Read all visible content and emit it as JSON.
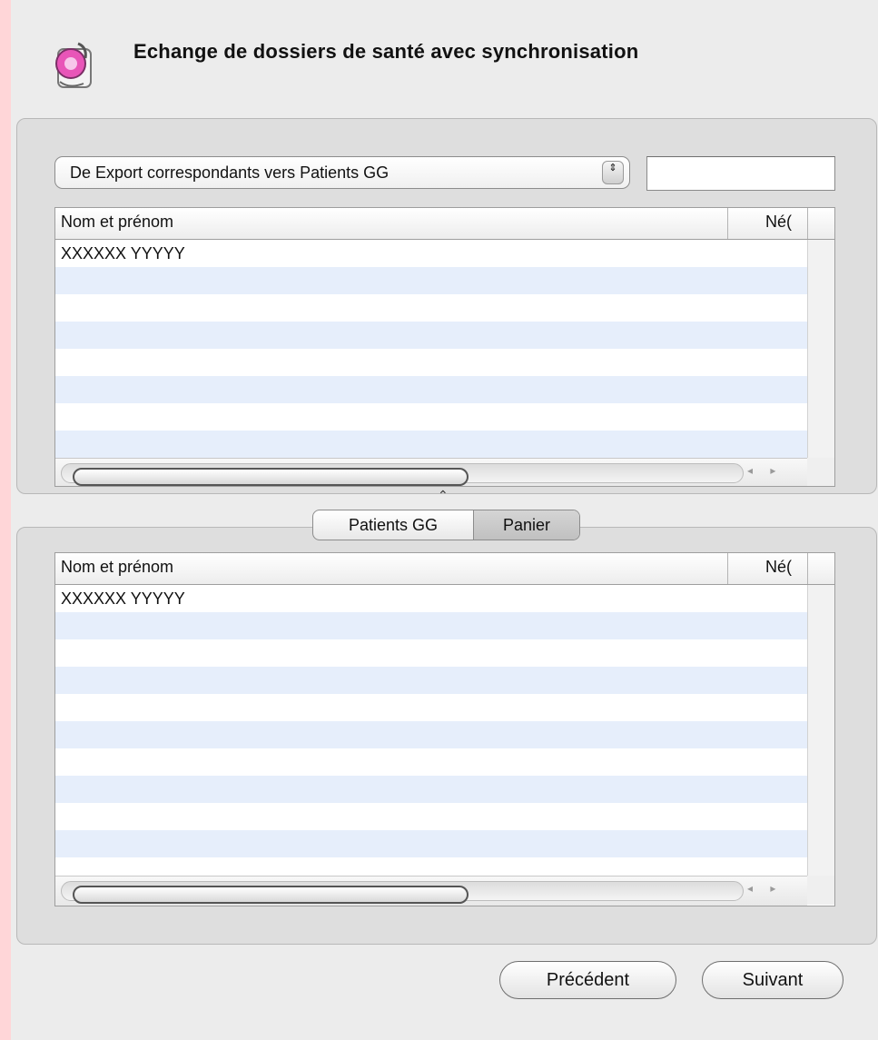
{
  "window": {
    "title": "Echange de dossiers de santé avec synchronisation"
  },
  "source_popup": {
    "selected": "De Export correspondants vers Patients GG",
    "stepper_glyph": "⇕"
  },
  "search": {
    "value": ""
  },
  "table_top": {
    "columns": [
      "Nom et prénom",
      "Né("
    ],
    "rows": [
      "XXXXXX YYYYY",
      "",
      "",
      "",
      "",
      "",
      "",
      ""
    ]
  },
  "segmented": {
    "tabs": [
      "Patients GG",
      "Panier"
    ],
    "selected": "Panier"
  },
  "table_bottom": {
    "columns": [
      "Nom et prénom",
      "Né("
    ],
    "rows": [
      "XXXXXX YYYYY",
      "",
      "",
      "",
      "",
      "",
      "",
      "",
      "",
      "",
      ""
    ]
  },
  "scroll_arrows": "◂ ▸",
  "split_handle": "⌃",
  "buttons": {
    "previous": "Précédent",
    "next": "Suivant"
  },
  "colors": {
    "background": "#ffd6d8",
    "window": "#ececec",
    "row_alt": "#e6eefb"
  }
}
